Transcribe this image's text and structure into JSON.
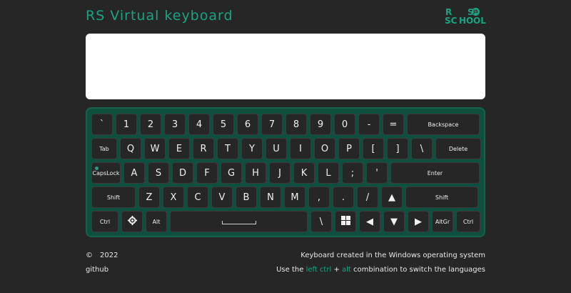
{
  "header": {
    "title": "RS Virtual keyboard",
    "logo": {
      "line1a": "R",
      "line1b": "S",
      "badge": "JS",
      "line2a": "SC",
      "line2b": "HO",
      "line2c": "OL"
    }
  },
  "textarea": {
    "value": "",
    "placeholder": ""
  },
  "keyboard": {
    "rows": [
      [
        {
          "label": "`",
          "name": "key-backquote"
        },
        {
          "label": "1",
          "name": "key-1"
        },
        {
          "label": "2",
          "name": "key-2"
        },
        {
          "label": "3",
          "name": "key-3"
        },
        {
          "label": "4",
          "name": "key-4"
        },
        {
          "label": "5",
          "name": "key-5"
        },
        {
          "label": "6",
          "name": "key-6"
        },
        {
          "label": "7",
          "name": "key-7"
        },
        {
          "label": "8",
          "name": "key-8"
        },
        {
          "label": "9",
          "name": "key-9"
        },
        {
          "label": "0",
          "name": "key-0"
        },
        {
          "label": "-",
          "name": "key-minus"
        },
        {
          "label": "=",
          "name": "key-equal"
        },
        {
          "label": "Backspace",
          "name": "key-backspace"
        }
      ],
      [
        {
          "label": "Tab",
          "name": "key-tab"
        },
        {
          "label": "Q",
          "name": "key-q"
        },
        {
          "label": "W",
          "name": "key-w"
        },
        {
          "label": "E",
          "name": "key-e"
        },
        {
          "label": "R",
          "name": "key-r"
        },
        {
          "label": "T",
          "name": "key-t"
        },
        {
          "label": "Y",
          "name": "key-y"
        },
        {
          "label": "U",
          "name": "key-u"
        },
        {
          "label": "I",
          "name": "key-i"
        },
        {
          "label": "O",
          "name": "key-o"
        },
        {
          "label": "P",
          "name": "key-p"
        },
        {
          "label": "[",
          "name": "key-bracket-left"
        },
        {
          "label": "]",
          "name": "key-bracket-right"
        },
        {
          "label": "\\",
          "name": "key-backslash"
        },
        {
          "label": "Delete",
          "name": "key-delete"
        }
      ],
      [
        {
          "label": "CapsLock",
          "name": "key-capslock"
        },
        {
          "label": "A",
          "name": "key-a"
        },
        {
          "label": "S",
          "name": "key-s"
        },
        {
          "label": "D",
          "name": "key-d"
        },
        {
          "label": "F",
          "name": "key-f"
        },
        {
          "label": "G",
          "name": "key-g"
        },
        {
          "label": "H",
          "name": "key-h"
        },
        {
          "label": "J",
          "name": "key-j"
        },
        {
          "label": "K",
          "name": "key-k"
        },
        {
          "label": "L",
          "name": "key-l"
        },
        {
          "label": ";",
          "name": "key-semicolon"
        },
        {
          "label": "'",
          "name": "key-quote"
        },
        {
          "label": "Enter",
          "name": "key-enter"
        }
      ],
      [
        {
          "label": "Shift",
          "name": "key-shift-left"
        },
        {
          "label": "Z",
          "name": "key-z"
        },
        {
          "label": "X",
          "name": "key-x"
        },
        {
          "label": "C",
          "name": "key-c"
        },
        {
          "label": "V",
          "name": "key-v"
        },
        {
          "label": "B",
          "name": "key-b"
        },
        {
          "label": "N",
          "name": "key-n"
        },
        {
          "label": "M",
          "name": "key-m"
        },
        {
          "label": ",",
          "name": "key-comma"
        },
        {
          "label": ".",
          "name": "key-period"
        },
        {
          "label": "/",
          "name": "key-slash"
        },
        {
          "label": "▲",
          "name": "key-arrow-up"
        },
        {
          "label": "Shift",
          "name": "key-shift-right"
        }
      ],
      [
        {
          "label": "Ctrl",
          "name": "key-ctrl-left"
        },
        {
          "label": "",
          "name": "key-theme",
          "icon": "settings-icon"
        },
        {
          "label": "Alt",
          "name": "key-alt-left"
        },
        {
          "label": "",
          "name": "key-space",
          "icon": "space-icon"
        },
        {
          "label": "\\",
          "name": "key-backslash-2"
        },
        {
          "label": "",
          "name": "key-win",
          "icon": "windows-icon"
        },
        {
          "label": "◀",
          "name": "key-arrow-left"
        },
        {
          "label": "▼",
          "name": "key-arrow-down"
        },
        {
          "label": "▶",
          "name": "key-arrow-right"
        },
        {
          "label": "AltGr",
          "name": "key-altgr"
        },
        {
          "label": "Ctrl",
          "name": "key-ctrl-right"
        }
      ]
    ]
  },
  "footer": {
    "copyright_symbol": "©",
    "year": "2022",
    "github": "github",
    "info": "Keyboard created in the Windows operating system",
    "hint_prefix": "Use the",
    "hint_ctrl": "left ctrl",
    "hint_plus": "+",
    "hint_alt": "alt",
    "hint_suffix": "combination to switch the languages"
  },
  "colors": {
    "accent": "#1aa383",
    "background": "#262626",
    "keyboard": "#0f4f3f",
    "key": "#262626"
  }
}
